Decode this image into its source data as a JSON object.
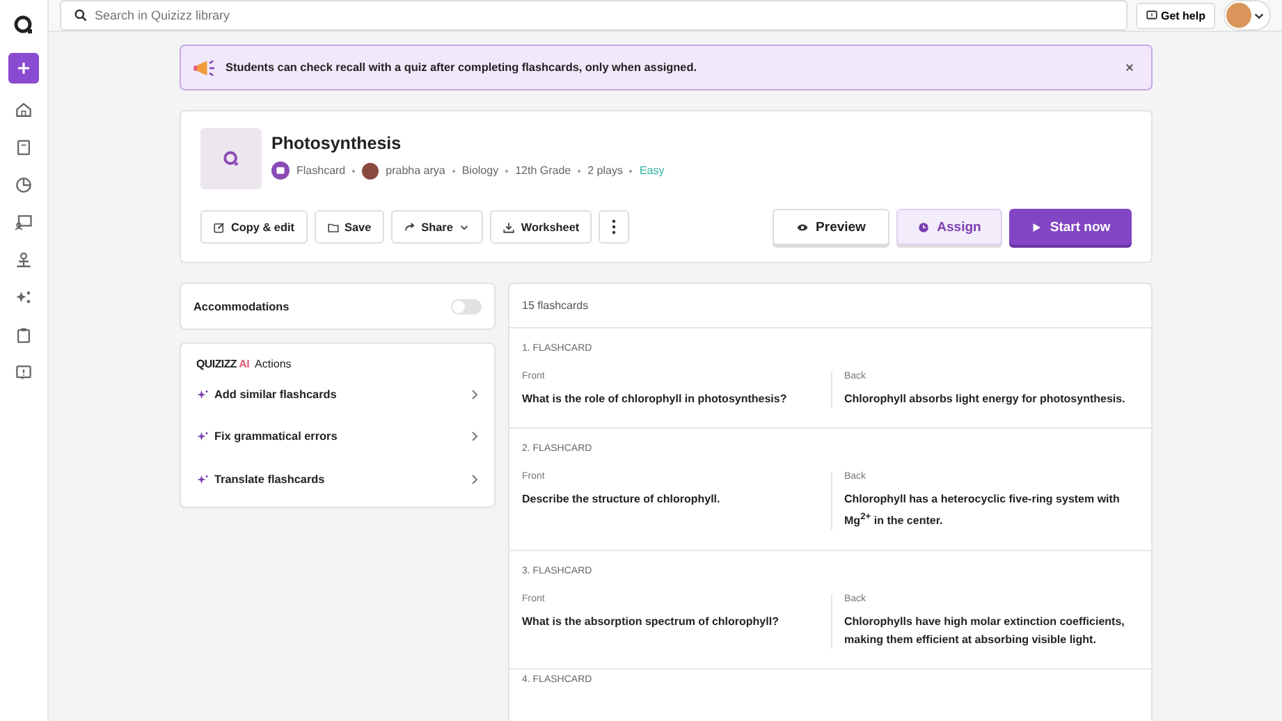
{
  "search": {
    "placeholder": "Search in Quizizz library"
  },
  "help_button": "Get help",
  "banner": {
    "text": "Students can check recall with a quiz after completing flashcards, only when assigned."
  },
  "quiz": {
    "title": "Photosynthesis",
    "type": "Flashcard",
    "author": "prabha arya",
    "meta": [
      "Biology",
      "12th Grade",
      "2 plays"
    ],
    "difficulty": "Easy"
  },
  "actions": [
    {
      "kind": "copy",
      "label": "Copy & edit"
    },
    {
      "kind": "save",
      "label": "Save"
    },
    {
      "kind": "share",
      "label": "Share"
    },
    {
      "kind": "worksheet",
      "label": "Worksheet"
    }
  ],
  "primary_actions": [
    {
      "kind": "preview",
      "label": "Preview"
    },
    {
      "kind": "assign",
      "label": "Assign"
    },
    {
      "kind": "start",
      "label": "Start now"
    }
  ],
  "accommodations": {
    "label": "Accommodations",
    "on": false
  },
  "ai_actions": {
    "brand": "QUIZIZZ",
    "brand_ai": "AI",
    "title": "Actions",
    "items": [
      "Add similar flashcards",
      "Fix grammatical errors",
      "Translate flashcards"
    ]
  },
  "flashcards": {
    "count": "15 flashcards",
    "items": [
      {
        "label": "1. FLASHCARD",
        "front_label": "Front",
        "back_label": "Back",
        "front": "What is the role of chlorophyll in photosynthesis?",
        "back": "Chlorophyll absorbs light energy for photosynthesis."
      },
      {
        "label": "2. FLASHCARD",
        "front_label": "Front",
        "back_label": "Back",
        "front": "Describe the structure of chlorophyll.",
        "back": "Chlorophyll has a heterocyclic five-ring system with Mg$^{2+}$ in the center."
      },
      {
        "label": "3. FLASHCARD",
        "front_label": "Front",
        "back_label": "Back",
        "front": "What is the absorption spectrum of chlorophyll?",
        "back": "Chlorophylls have high molar extinction coefficients, making them efficient at absorbing visible light."
      }
    ],
    "partial_label": "4. FLASHCARD"
  }
}
